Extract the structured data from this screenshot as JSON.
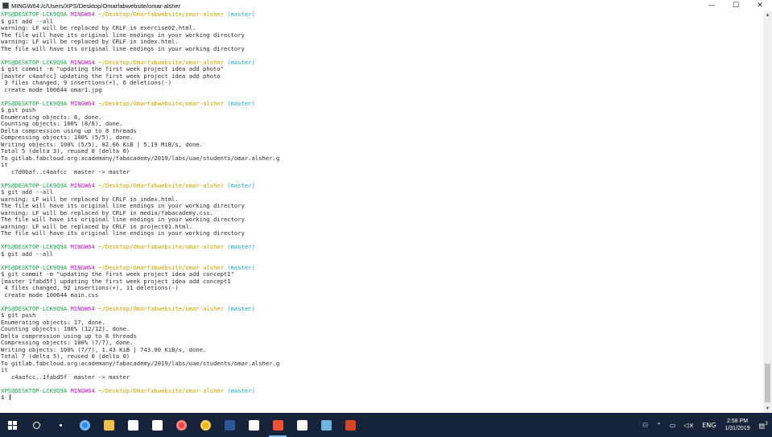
{
  "window": {
    "title": "MINGW64:/c/Users/XPS/Desktop/Omarfabwebsite/omar-alsher",
    "min": "—",
    "max": "☐",
    "close": "✕"
  },
  "prompt": {
    "user": "XPS@DESKTOP-LCK9Q9A",
    "env": "MINGW64",
    "path": "~/Desktop/Omarfabwebsite/omar-alsher",
    "branch": "(master)"
  },
  "terminal_lines": [
    {
      "type": "prompt"
    },
    {
      "type": "text",
      "text": "$ git add --all"
    },
    {
      "type": "text",
      "text": "warning: LF will be replaced by CRLF in exercise02.html."
    },
    {
      "type": "text",
      "text": "The file will have its original line endings in your working directory"
    },
    {
      "type": "text",
      "text": "warning: LF will be replaced by CRLF in index.html."
    },
    {
      "type": "text",
      "text": "The file will have its original line endings in your working directory"
    },
    {
      "type": "blank"
    },
    {
      "type": "prompt"
    },
    {
      "type": "text",
      "text": "$ git commit -m \"updating the first week project idea add photo\""
    },
    {
      "type": "text",
      "text": "[master c4aafcc] updating the first week project idea add photo"
    },
    {
      "type": "text",
      "text": " 3 files changed, 9 insertions(+), 6 deletions(-)"
    },
    {
      "type": "text",
      "text": " create mode 100644 omar1.jpg"
    },
    {
      "type": "blank"
    },
    {
      "type": "prompt"
    },
    {
      "type": "text",
      "text": "$ git push"
    },
    {
      "type": "text",
      "text": "Enumerating objects: 8, done."
    },
    {
      "type": "text",
      "text": "Counting objects: 100% (8/8), done."
    },
    {
      "type": "text",
      "text": "Delta compression using up to 8 threads"
    },
    {
      "type": "text",
      "text": "Compressing objects: 100% (5/5), done."
    },
    {
      "type": "text",
      "text": "Writing objects: 100% (5/5), 82.66 KiB | 5.19 MiB/s, done."
    },
    {
      "type": "text",
      "text": "Total 5 (delta 3), reused 0 (delta 0)"
    },
    {
      "type": "text",
      "text": "To gitlab.fabcloud.org:academany/fabacademy/2019/labs/uae/students/omar.alsher.g"
    },
    {
      "type": "text",
      "text": "it"
    },
    {
      "type": "text",
      "text": "   c7d0baf..c4aafcc  master -> master"
    },
    {
      "type": "blank"
    },
    {
      "type": "prompt"
    },
    {
      "type": "text",
      "text": "$ git add --all"
    },
    {
      "type": "text",
      "text": "warning: LF will be replaced by CRLF in index.html."
    },
    {
      "type": "text",
      "text": "The file will have its original line endings in your working directory"
    },
    {
      "type": "text",
      "text": "warning: LF will be replaced by CRLF in media/fabacademy.css."
    },
    {
      "type": "text",
      "text": "The file will have its original line endings in your working directory"
    },
    {
      "type": "text",
      "text": "warning: LF will be replaced by CRLF in project01.html."
    },
    {
      "type": "text",
      "text": "The file will have its original line endings in your working directory"
    },
    {
      "type": "blank"
    },
    {
      "type": "prompt"
    },
    {
      "type": "text",
      "text": "$ git add --all"
    },
    {
      "type": "blank"
    },
    {
      "type": "prompt"
    },
    {
      "type": "text",
      "text": "$ git commit -m \"updating the first week project idea add concept1\""
    },
    {
      "type": "text",
      "text": "[master 1fabd5f] updating the first week project idea add concept1"
    },
    {
      "type": "text",
      "text": " 4 files changed, 92 insertions(+), 11 deletions(-)"
    },
    {
      "type": "text",
      "text": " create mode 100644 main.css"
    },
    {
      "type": "blank"
    },
    {
      "type": "prompt"
    },
    {
      "type": "text",
      "text": "$ git push"
    },
    {
      "type": "text",
      "text": "Enumerating objects: 17, done."
    },
    {
      "type": "text",
      "text": "Counting objects: 100% (12/12), done."
    },
    {
      "type": "text",
      "text": "Delta compression using up to 8 threads"
    },
    {
      "type": "text",
      "text": "Compressing objects: 100% (7/7), done."
    },
    {
      "type": "text",
      "text": "Writing objects: 100% (7/7), 1.43 KiB | 743.00 KiB/s, done."
    },
    {
      "type": "text",
      "text": "Total 7 (delta 5), reused 0 (delta 0)"
    },
    {
      "type": "text",
      "text": "To gitlab.fabcloud.org:academany/fabacademy/2019/labs/uae/students/omar.alsher.g"
    },
    {
      "type": "text",
      "text": "it"
    },
    {
      "type": "text",
      "text": "   c4aafcc..1fabd5f  master -> master"
    },
    {
      "type": "blank"
    },
    {
      "type": "prompt"
    },
    {
      "type": "input",
      "text": "$ "
    }
  ],
  "taskbar": {
    "icons": [
      {
        "name": "start-icon",
        "color": "#ffffff"
      },
      {
        "name": "search-icon",
        "color": "#ffffff"
      },
      {
        "name": "task-view-icon",
        "color": "#ffffff"
      },
      {
        "name": "edge-icon",
        "color": "#2e8ae6"
      },
      {
        "name": "file-explorer-icon",
        "color": "#f2c14e"
      },
      {
        "name": "mail-icon",
        "color": "#ffffff"
      },
      {
        "name": "store-icon",
        "color": "#ffffff"
      },
      {
        "name": "chrome-icon",
        "color": "#e8453c"
      },
      {
        "name": "chrome-icon",
        "color": "#f0b400"
      },
      {
        "name": "word-icon",
        "color": "#2b5797"
      },
      {
        "name": "settings-icon",
        "color": "#ffffff"
      },
      {
        "name": "git-bash-icon",
        "color": "#f05133",
        "active": true
      },
      {
        "name": "photos-icon",
        "color": "#ffffff"
      },
      {
        "name": "app-icon",
        "color": "#6fb3e0"
      },
      {
        "name": "app-icon",
        "color": "#d24726"
      }
    ],
    "lang": "ENG",
    "time": "2:58 PM",
    "date": "1/31/2019",
    "notification_count": "3"
  }
}
